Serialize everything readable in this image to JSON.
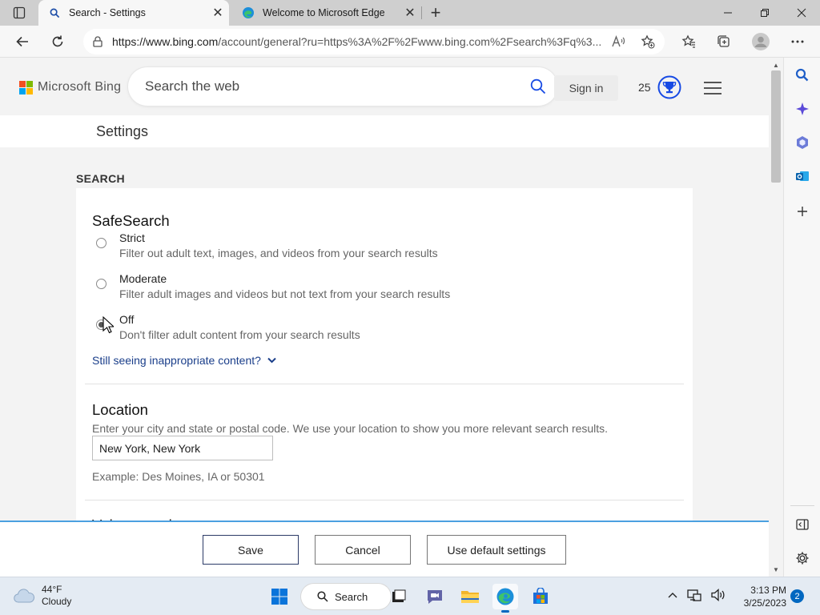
{
  "browser": {
    "tabs": [
      {
        "title": "Search - Settings",
        "active": true
      },
      {
        "title": "Welcome to Microsoft Edge",
        "active": false
      }
    ],
    "url_main": "https://www.bing.com",
    "url_rest": "/account/general?ru=https%3A%2F%2Fwww.bing.com%2Fsearch%3Fq%3..."
  },
  "bing": {
    "logo_text": "Microsoft Bing",
    "search_placeholder": "Search the web",
    "signin_label": "Sign in",
    "rewards_count": "25"
  },
  "settings": {
    "title": "Settings",
    "section_label": "SEARCH",
    "safesearch": {
      "heading": "SafeSearch",
      "options": [
        {
          "label": "Strict",
          "desc": "Filter out adult text, images, and videos from your search results",
          "checked": false
        },
        {
          "label": "Moderate",
          "desc": "Filter adult images and videos but not text from your search results",
          "checked": false
        },
        {
          "label": "Off",
          "desc": "Don't filter adult content from your search results",
          "checked": true
        }
      ],
      "still_seeing": "Still seeing inappropriate content?"
    },
    "location": {
      "heading": "Location",
      "desc": "Enter your city and state or postal code. We use your location to show you more relevant search results.",
      "value": "New York, New York",
      "example": "Example: Des Moines, IA or 50301"
    },
    "next_heading": "Voice search"
  },
  "actions": {
    "save": "Save",
    "cancel": "Cancel",
    "default": "Use default settings"
  },
  "taskbar": {
    "weather_temp": "44°F",
    "weather_cond": "Cloudy",
    "search_label": "Search",
    "time": "3:13 PM",
    "date": "3/25/2023",
    "notifications": "2"
  },
  "colors": {
    "accent": "#0067c0",
    "bing_blue": "#174ae4",
    "link": "#1a3e8a",
    "action_bar_border": "#4ba0e0"
  }
}
